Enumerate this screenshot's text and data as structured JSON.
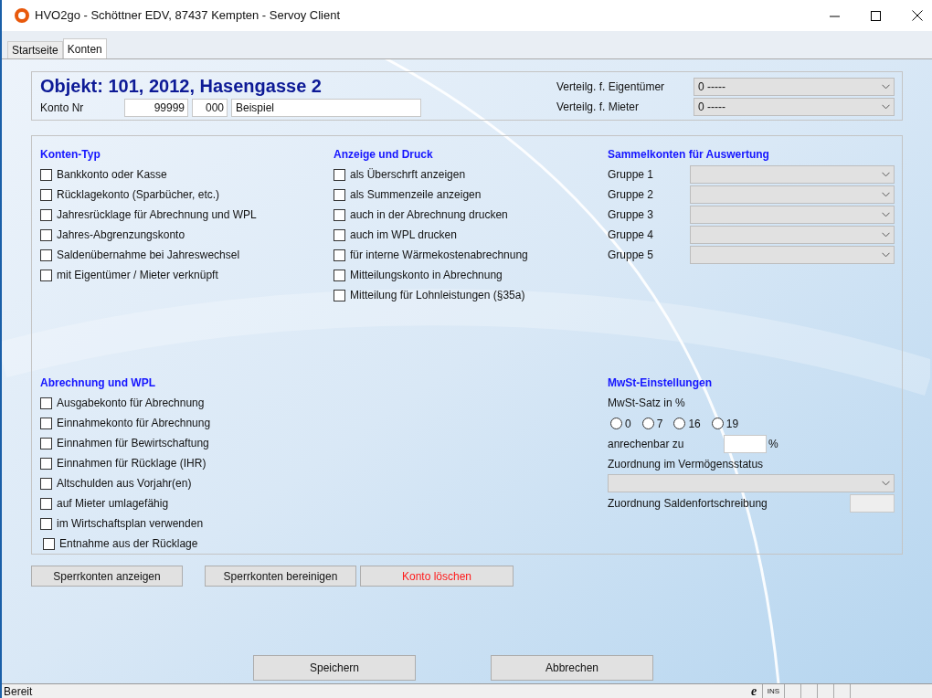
{
  "window": {
    "title": "HVO2go - Schöttner EDV, 87437 Kempten  - Servoy Client"
  },
  "tabs": [
    {
      "label": "Startseite",
      "selected": false
    },
    {
      "label": "Konten",
      "selected": true
    }
  ],
  "header": {
    "title": "Objekt: 101, 2012, Hasengasse 2",
    "konto_label": "Konto Nr",
    "konto_nr": "99999",
    "sub_nr": "000",
    "name": "Beispiel",
    "distribution": [
      {
        "label": "Verteilg. f. Eigentümer",
        "value": "0 -----"
      },
      {
        "label": "Verteilg. f. Mieter",
        "value": "0 -----"
      }
    ]
  },
  "konten_typ": {
    "title": "Konten-Typ",
    "options": [
      {
        "label": "Bankkonto oder Kasse",
        "checked": false
      },
      {
        "label": "Rücklagekonto (Sparbücher, etc.)",
        "checked": false
      },
      {
        "label": "Jahresrücklage für Abrechnung und WPL",
        "checked": false
      },
      {
        "label": "Jahres-Abgrenzungskonto",
        "checked": false
      },
      {
        "label": "Saldenübernahme bei Jahreswechsel",
        "checked": false
      },
      {
        "label": "mit Eigentümer / Mieter verknüpft",
        "checked": false
      }
    ]
  },
  "anzeige": {
    "title": "Anzeige und Druck",
    "options": [
      {
        "label": "als Überschrft anzeigen",
        "checked": false
      },
      {
        "label": "als Summenzeile anzeigen",
        "checked": false
      },
      {
        "label": "auch in der Abrechnung drucken",
        "checked": false
      },
      {
        "label": "auch im WPL drucken",
        "checked": false
      },
      {
        "label": "für interne Wärmekostenabrechnung",
        "checked": false
      },
      {
        "label": "Mitteilungskonto in Abrechnung",
        "checked": false
      },
      {
        "label": "Mitteilung für Lohnleistungen (§35a)",
        "checked": false
      }
    ]
  },
  "sammelkonten": {
    "title": "Sammelkonten für Auswertung",
    "groups": [
      {
        "label": "Gruppe 1"
      },
      {
        "label": "Gruppe 2"
      },
      {
        "label": "Gruppe 3"
      },
      {
        "label": "Gruppe 4"
      },
      {
        "label": "Gruppe 5"
      }
    ]
  },
  "abrechnung": {
    "title": "Abrechnung und WPL",
    "options": [
      {
        "label": "Ausgabekonto für Abrechnung",
        "checked": false
      },
      {
        "label": "Einnahmekonto für Abrechnung",
        "checked": false
      },
      {
        "label": "Einnahmen für Bewirtschaftung",
        "checked": false
      },
      {
        "label": "Einnahmen für Rücklage (IHR)",
        "checked": false
      },
      {
        "label": "Altschulden aus Vorjahr(en)",
        "checked": false
      },
      {
        "label": "auf Mieter umlagefähig",
        "checked": false
      },
      {
        "label": "im Wirtschaftsplan verwenden",
        "checked": false
      },
      {
        "label": "Entnahme aus der Rücklage",
        "checked": false
      }
    ]
  },
  "mwst": {
    "title": "MwSt-Einstellungen",
    "rate_label": "MwSt-Satz in %",
    "rates": [
      {
        "label": "0",
        "selected": false
      },
      {
        "label": "7",
        "selected": false
      },
      {
        "label": "16",
        "selected": false
      },
      {
        "label": "19",
        "selected": false
      }
    ],
    "creditable_label": "anrechenbar zu",
    "creditable_unit": "%",
    "assignment_label": "Zuordnung im Vermögensstatus",
    "balance_label": "Zuordnung Saldenfortschreibung"
  },
  "actions": [
    {
      "label": "Sperrkonten anzeigen",
      "kind": "normal"
    },
    {
      "label": "Sperrkonten bereinigen",
      "kind": "normal"
    },
    {
      "label": "Konto löschen",
      "kind": "danger"
    }
  ],
  "dialog_buttons": [
    "Speichern",
    "Abbrechen"
  ],
  "status_bar": {
    "text": "Bereit",
    "browser_glyph": "e",
    "mode": "INS"
  }
}
